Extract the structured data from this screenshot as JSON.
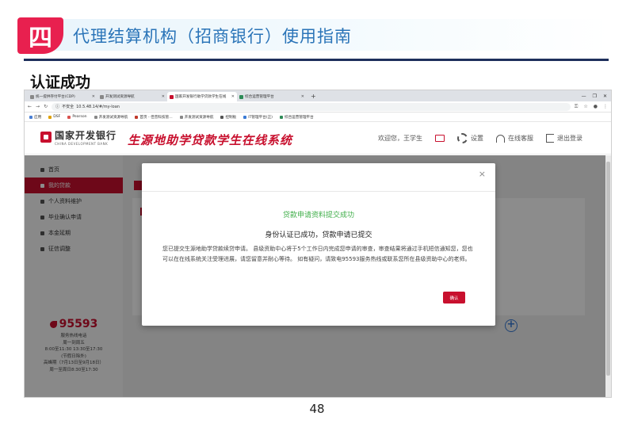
{
  "slide": {
    "badge": "四",
    "title": "代理结算机构（招商银行）使用指南",
    "section": "认证成功",
    "page_number": "48"
  },
  "browser": {
    "tabs": [
      {
        "label": "统一提供存付平台(CDP)",
        "active": false
      },
      {
        "label": "开发测试资源导航",
        "active": false
      },
      {
        "label": "国家开发银行助学贷款学生在线",
        "active": true
      },
      {
        "label": "综合运营管理平台",
        "active": false
      }
    ],
    "new_tab": "+",
    "window_controls": [
      "—",
      "❐",
      "✕"
    ],
    "security_label": "不安全",
    "url": "10.5.48.14/#/my-loan",
    "bookmarks": [
      {
        "label": "应用",
        "color": "#4a7fd4"
      },
      {
        "label": "DSF",
        "color": "#e0a100"
      },
      {
        "label": "Pearson",
        "color": "#d9534f"
      },
      {
        "label": "开发测试资源导航",
        "color": "#888888"
      },
      {
        "label": "首页 - 佳普科技管…",
        "color": "#c0392b"
      },
      {
        "label": "开发测试资源导航",
        "color": "#888888"
      },
      {
        "label": "控制板",
        "color": "#555555"
      },
      {
        "label": "IT管理平台(正)",
        "color": "#3a7bd5"
      },
      {
        "label": "综合运营管理平台",
        "color": "#2e8b57"
      }
    ]
  },
  "site": {
    "bank_name_cn": "国家开发银行",
    "bank_name_en": "CHINA DEVELOPMENT BANK",
    "system_title": "生源地助学贷款学生在线系统",
    "welcome": "欢迎您，王学生",
    "settings": "设置",
    "online_service": "在线客服",
    "logout": "退出登录"
  },
  "sidebar": {
    "items": [
      {
        "label": "首页",
        "active": false
      },
      {
        "label": "我的贷款",
        "active": true
      },
      {
        "label": "个人资料维护",
        "active": false
      },
      {
        "label": "毕业确认申请",
        "active": false
      },
      {
        "label": "本金延期",
        "active": false
      },
      {
        "label": "征信调整",
        "active": false
      }
    ],
    "hotline": {
      "number": "95593",
      "lines": [
        "服务热线电话",
        "周一到周五",
        "8:00至11:30 13:30至17:30",
        "(节假日除外)",
        "高峰期（7月13日至9月18日）",
        "周一至周日8:30至17:30"
      ]
    }
  },
  "modal": {
    "close": "×",
    "heading": "贷款申请资料提交成功",
    "subheading": "身份认证已成功，贷款申请已提交",
    "body": "您已提交生源地助学贷款续贷申请。 县级资助中心将于5个工作日内完成您申请的审查，审查结果将通过手机短信通知您，您也可以在在线系统关注受理进展，请您留意并耐心等待。 如有疑问，请致电95593服务热线或联系您所在县级资助中心的老师。",
    "ok_button": "确认"
  },
  "colors": {
    "brand_red": "#c8102e",
    "slide_pink": "#e8204f",
    "slide_blue": "#2a74b8",
    "success_green": "#3fae49"
  }
}
